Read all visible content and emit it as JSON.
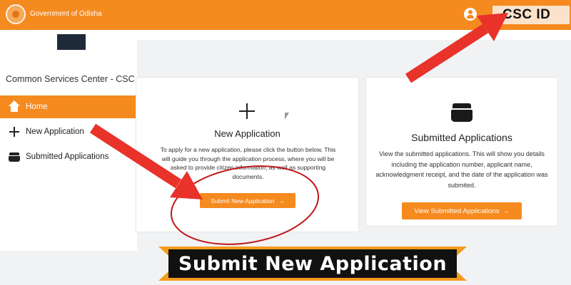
{
  "header": {
    "gov_title": "Government of Odisha",
    "csc_id": "CSC ID"
  },
  "sidebar": {
    "brand": "Common Services Center - CSC",
    "items": [
      {
        "label": "Home",
        "icon": "home-icon",
        "active": true
      },
      {
        "label": "New Application",
        "icon": "plus-icon",
        "active": false
      },
      {
        "label": "Submitted Applications",
        "icon": "archive-icon",
        "active": false
      }
    ]
  },
  "cards": {
    "new_application": {
      "title": "New Application",
      "description": "To apply for a new application, please click the button below. This will guide you through the application process, where you will be asked to provide citizen information, as well as supporting documents.",
      "button": "Submit New Application",
      "button_arrow": "→"
    },
    "submitted_applications": {
      "title": "Submitted Applications",
      "description": "View the submitted applications. This will show you details including the application number, applicant name, acknowledgment receipt, and the date of the application was submited.",
      "button": "View Submitted Applications",
      "button_arrow": "→"
    }
  },
  "annotation": {
    "banner": "Submit New Application"
  },
  "colors": {
    "accent": "#f58a1f",
    "arrow_red": "#e8322a",
    "banner_bg": "#111111",
    "banner_border": "#f59a1c"
  }
}
